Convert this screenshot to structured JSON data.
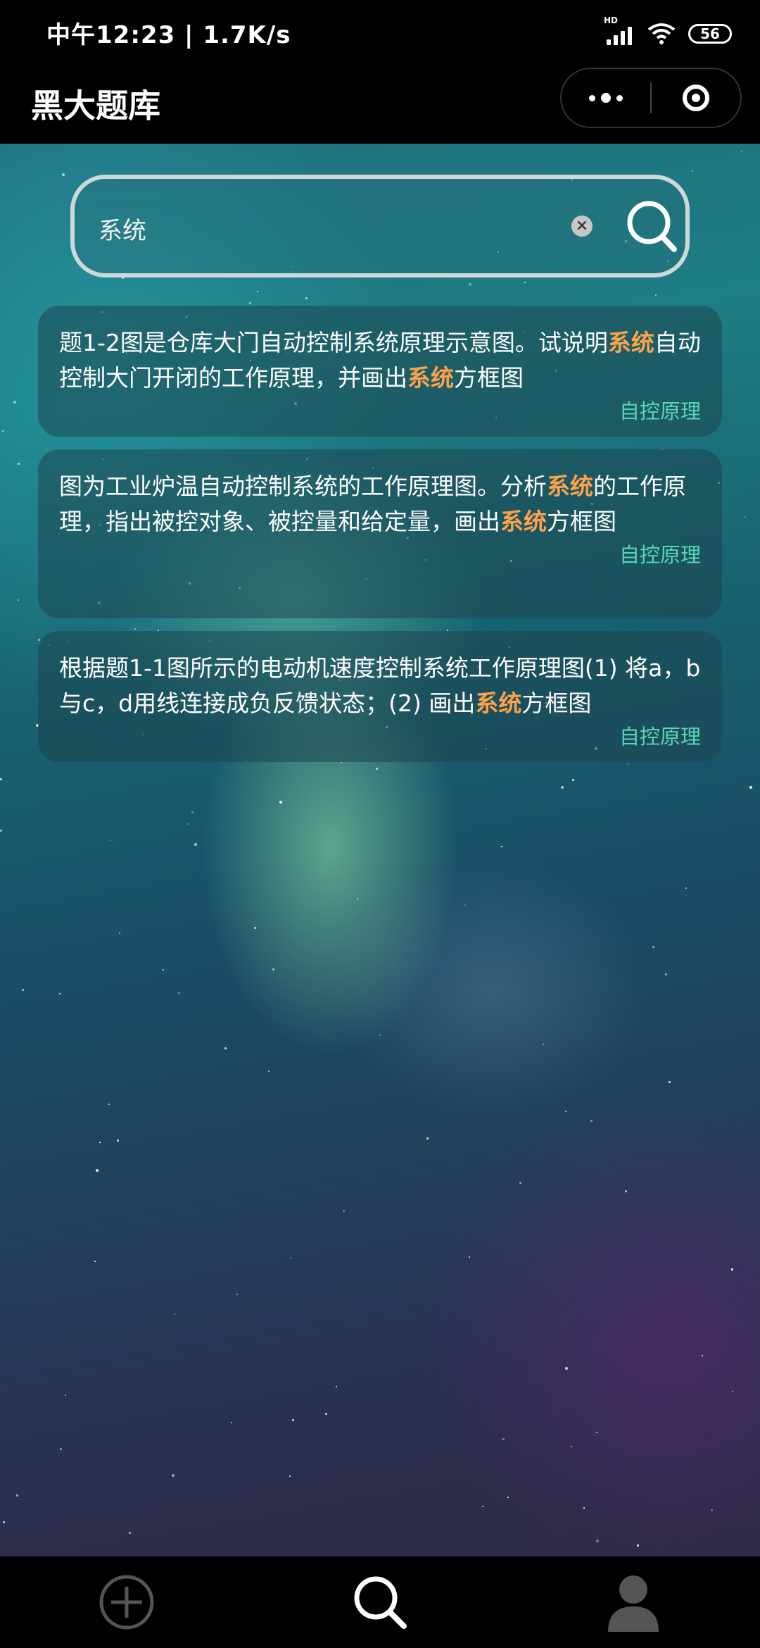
{
  "status_bar": {
    "time_net": "中午12:23 | 1.7K/s",
    "signal_label": "HD",
    "battery": "56"
  },
  "nav": {
    "title": "黑大题库"
  },
  "search": {
    "value": "系统",
    "clear_icon": "clear-icon",
    "search_icon": "search-icon"
  },
  "results": [
    {
      "parts": [
        {
          "t": "题1-2图是仓库大门自动控制系统原理示意图。试说明",
          "h": false
        },
        {
          "t": "系统",
          "h": true
        },
        {
          "t": "自动控制大门开闭的工作原理，并画出",
          "h": false
        },
        {
          "t": "系统",
          "h": true
        },
        {
          "t": "方框图",
          "h": false
        }
      ],
      "subject": "自控原理"
    },
    {
      "parts": [
        {
          "t": "图为工业炉温自动控制系统的工作原理图。分析",
          "h": false
        },
        {
          "t": "系统",
          "h": true
        },
        {
          "t": "的工作原理，指出被控对象、被控量和给定量，画出",
          "h": false
        },
        {
          "t": "系统",
          "h": true
        },
        {
          "t": "方框图",
          "h": false
        }
      ],
      "subject": "自控原理"
    },
    {
      "parts": [
        {
          "t": "根据题1-1图所示的电动机速度控制系统工作原理图(1) 将a，b与c，d用线连接成负反馈状态；(2) 画出",
          "h": false
        },
        {
          "t": "系统",
          "h": true
        },
        {
          "t": "方框图",
          "h": false
        }
      ],
      "subject": "自控原理"
    }
  ],
  "tab_bar": {
    "items": [
      "add-circle-icon",
      "search-icon",
      "user-icon"
    ],
    "active_color": "#ffffff",
    "inactive_color": "#555555"
  }
}
